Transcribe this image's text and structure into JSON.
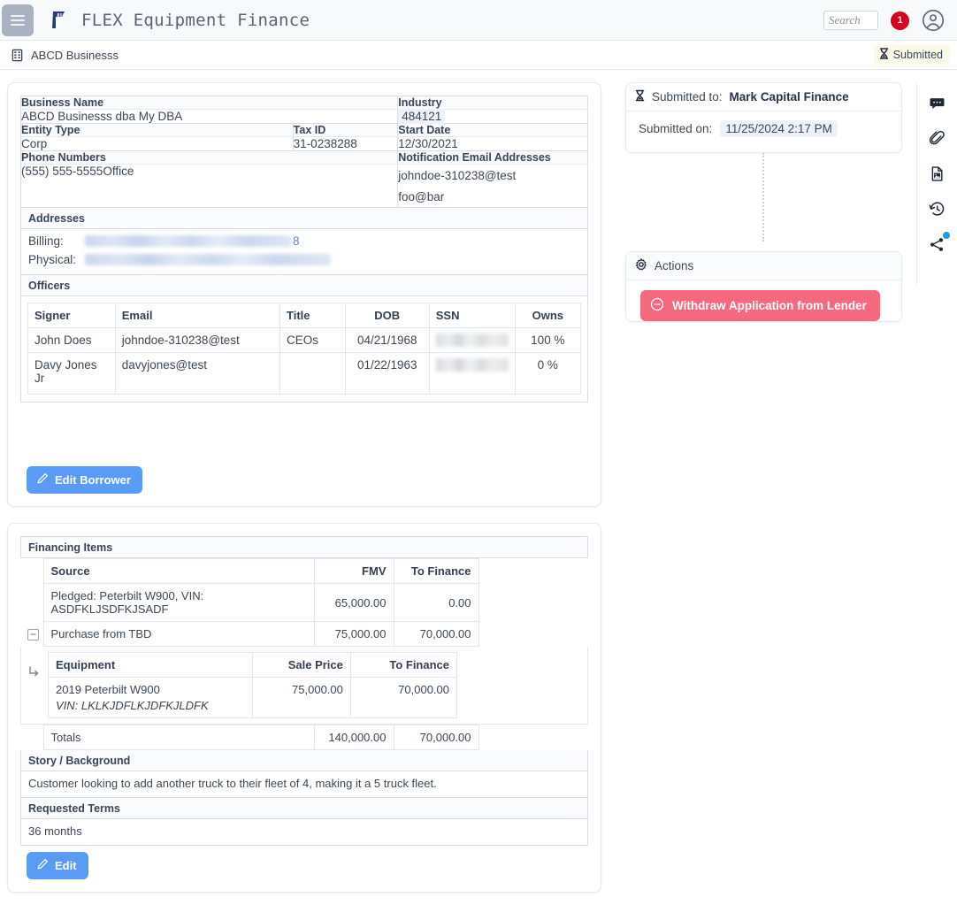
{
  "navbar": {
    "menu_icon": "hamburger-icon",
    "logo_icon": "flex-logo-icon",
    "title": "FLEX Equipment Finance",
    "search_placeholder": "Search",
    "notification_count": "1",
    "avatar_icon": "user-avatar-icon"
  },
  "breadcrumb": {
    "icon": "building-icon",
    "label": "ABCD Businesss",
    "status_icon": "hourglass-icon",
    "status_label": "Submitted"
  },
  "borrower": {
    "business_name_label": "Business Name",
    "business_name_value": "ABCD Businesss dba My DBA",
    "industry_label": "Industry",
    "industry_value": "484121",
    "entity_type_label": "Entity Type",
    "entity_type_value": "Corp",
    "tax_id_label": "Tax ID",
    "tax_id_value": "31-0238288",
    "start_date_label": "Start Date",
    "start_date_value": "12/30/2021",
    "phone_numbers_label": "Phone Numbers",
    "phone_numbers_value": "(555) 555-5555Office",
    "notification_emails_label": "Notification Email Addresses",
    "notification_emails": [
      "johndoe-310238@test",
      "foo@bar"
    ],
    "addresses_label": "Addresses",
    "billing_label": "Billing:",
    "billing_value_visible_tail": "8",
    "physical_label": "Physical:",
    "officers_label": "Officers",
    "officers_columns": [
      "Signer",
      "Email",
      "Title",
      "DOB",
      "SSN",
      "Owns"
    ],
    "officers_rows": [
      {
        "signer": "John Does",
        "email": "johndoe-310238@test",
        "title": "CEOs",
        "dob": "04/21/1968",
        "ssn": "",
        "owns": "100 %"
      },
      {
        "signer": "Davy Jones Jr",
        "email": "davyjones@test",
        "title": "",
        "dob": "01/22/1963",
        "ssn": "",
        "owns": "0 %"
      }
    ],
    "edit_button_label": "Edit Borrower",
    "edit_button_icon": "pencil-icon"
  },
  "financing": {
    "section_label": "Financing Items",
    "columns": [
      "Source",
      "FMV",
      "To Finance"
    ],
    "rows": [
      {
        "source": "Pledged: Peterbilt W900, VIN: ASDFKLJSDFKJSADF",
        "fmv": "65,000.00",
        "to_finance": "0.00",
        "expandable": false
      },
      {
        "source": "Purchase from TBD",
        "fmv": "75,000.00",
        "to_finance": "70,000.00",
        "expandable": true
      }
    ],
    "sub_table": {
      "columns": [
        "Equipment",
        "Sale Price",
        "To Finance"
      ],
      "rows": [
        {
          "equipment": "2019 Peterbilt W900",
          "vin": "VIN: LKLKJDFLKJDFKJLDFK",
          "sale_price": "75,000.00",
          "to_finance": "70,000.00"
        }
      ]
    },
    "totals_label": "Totals",
    "totals_fmv": "140,000.00",
    "totals_to_finance": "70,000.00",
    "story_label": "Story / Background",
    "story_value": "Customer looking to add another truck to their fleet of 4, making it a 5 truck fleet.",
    "terms_label": "Requested Terms",
    "terms_value": "36 months",
    "edit_button_label": "Edit",
    "edit_button_icon": "pencil-icon"
  },
  "submitted_panel": {
    "icon": "hourglass-icon",
    "prefix": "Submitted to:",
    "lender": "Mark Capital Finance",
    "submitted_on_label": "Submitted on:",
    "submitted_on_value": "11/25/2024 2:17 PM"
  },
  "actions_panel": {
    "icon": "gear-icon",
    "title": "Actions",
    "withdraw_button_label": "Withdraw Application from Lender",
    "withdraw_button_icon": "minus-circle-icon"
  },
  "rail": {
    "items": [
      {
        "name": "comments-icon"
      },
      {
        "name": "attachment-icon"
      },
      {
        "name": "document-image-icon"
      },
      {
        "name": "history-icon"
      },
      {
        "name": "share-icon",
        "badge": true
      }
    ]
  },
  "colors": {
    "accent_blue": "#5b9bf8",
    "danger_red": "#f4697d",
    "notification_red": "#d6001c",
    "status_badge_bg": "#fdf9e7",
    "rail_badge_blue": "#1e9ae0"
  }
}
